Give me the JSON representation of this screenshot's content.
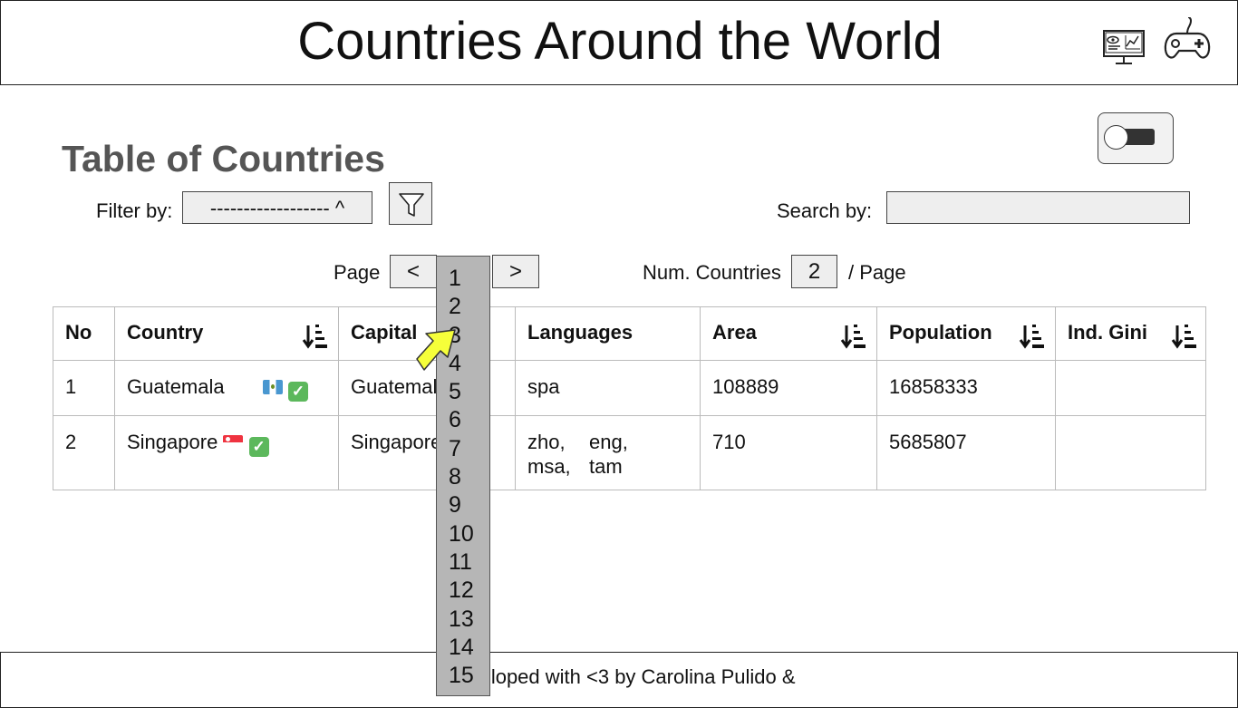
{
  "header": {
    "title": "Countries Around the World",
    "icons": [
      "dashboard-monitor-icon",
      "gamepad-icon"
    ]
  },
  "main": {
    "section_title": "Table of Countries",
    "toggle": {
      "state": "off"
    },
    "filter": {
      "label": "Filter by:",
      "selected": "------------------ ^",
      "button_icon": "funnel-icon"
    },
    "search": {
      "label": "Search by:",
      "value": ""
    },
    "pagination": {
      "page_label": "Page",
      "prev_label": "<",
      "next_label": ">",
      "page_options": [
        "1",
        "2",
        "3",
        "4",
        "5",
        "6",
        "7",
        "8",
        "9",
        "10",
        "11",
        "12",
        "13",
        "14",
        "15"
      ],
      "num_countries_label": "Num. Countries",
      "num_countries_value": "2",
      "per_page_label": "/ Page"
    },
    "table": {
      "columns": [
        "No",
        "Country",
        "Capital",
        "Languages",
        "Area",
        "Population",
        "Ind. Gini"
      ],
      "sortable_columns": [
        "Country",
        "Area",
        "Population",
        "Ind. Gini"
      ],
      "rows": [
        {
          "no": "1",
          "country": "Guatemala",
          "flag": "flag-guatemala-icon",
          "check": "✅",
          "capital": "Guatemala City",
          "languages": [
            "spa"
          ],
          "area": "108889",
          "population": "16858333",
          "gini": ""
        },
        {
          "no": "2",
          "country": "Singapore",
          "flag": "flag-singapore-icon",
          "check": "✅",
          "capital": "Singapore",
          "languages": [
            "zho,",
            "eng,",
            "msa,",
            "tam"
          ],
          "area": "710",
          "population": "5685807",
          "gini": ""
        }
      ]
    }
  },
  "footer": {
    "text": "Developed with <3 by Carolina Pulido &"
  },
  "colors": {
    "dropdown_bg": "#b6b6b6",
    "section_title": "#555555",
    "cursor_fill": "#f6ff3a"
  }
}
